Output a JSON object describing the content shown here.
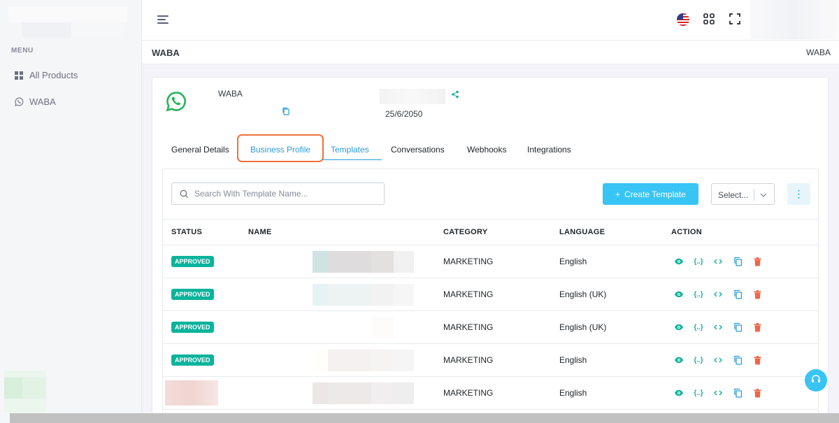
{
  "sidebar": {
    "menu_title": "MENU",
    "items": [
      {
        "label": "All Products",
        "icon": "grid-icon"
      },
      {
        "label": "WABA",
        "icon": "whatsapp-icon"
      }
    ]
  },
  "topbar": {
    "language_flag": "us-flag-icon"
  },
  "page": {
    "title": "WABA",
    "breadcrumb": "WABA"
  },
  "account": {
    "name": "WABA",
    "date": "25/6/2050"
  },
  "tabs": [
    {
      "label": "General Details"
    },
    {
      "label": "Business Profile"
    },
    {
      "label": "Templates"
    },
    {
      "label": "Conversations"
    },
    {
      "label": "Webhooks"
    },
    {
      "label": "Integrations"
    }
  ],
  "toolbar": {
    "search_placeholder": "Search With Template Name...",
    "create_label": "Create Template",
    "select_value": "Select..."
  },
  "table": {
    "headers": [
      "STATUS",
      "NAME",
      "CATEGORY",
      "LANGUAGE",
      "ACTION"
    ],
    "rows": [
      {
        "status": "APPROVED",
        "category": "MARKETING",
        "language": "English"
      },
      {
        "status": "APPROVED",
        "category": "MARKETING",
        "language": "English (UK)"
      },
      {
        "status": "APPROVED",
        "category": "MARKETING",
        "language": "English (UK)"
      },
      {
        "status": "APPROVED",
        "category": "MARKETING",
        "language": "English"
      },
      {
        "status": "",
        "category": "MARKETING",
        "language": "English"
      }
    ]
  },
  "colors": {
    "accent_blue": "#38c4f5",
    "success_green": "#0ab39c",
    "danger_red": "#f06548",
    "tab_highlight": "#f0703a"
  }
}
